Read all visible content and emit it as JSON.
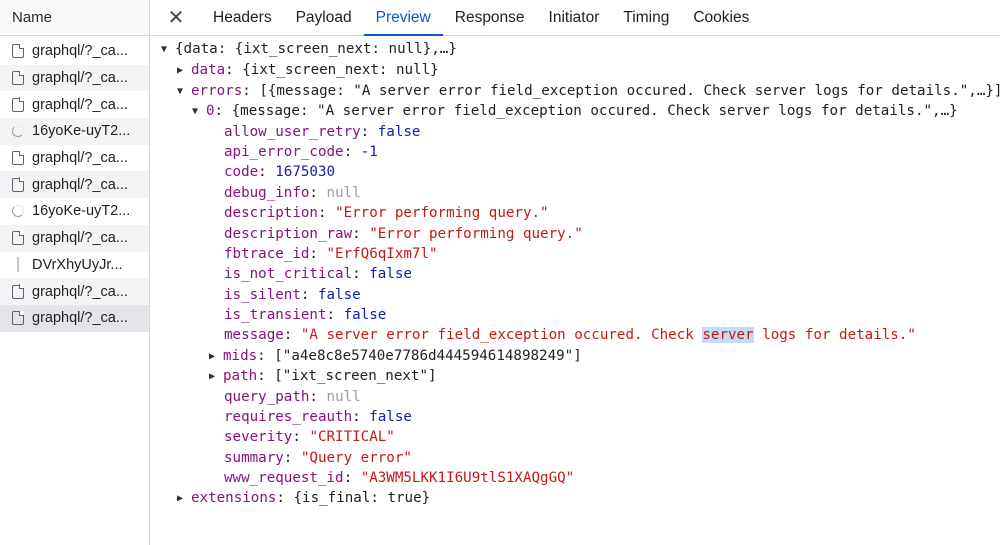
{
  "request_list": {
    "header": "Name",
    "rows": [
      {
        "icon": "document-icon",
        "name": "graphql/?_ca..."
      },
      {
        "icon": "document-icon",
        "name": "graphql/?_ca..."
      },
      {
        "icon": "document-icon",
        "name": "graphql/?_ca..."
      },
      {
        "icon": "loading-spinner-icon",
        "name": "16yoKe-uyT2..."
      },
      {
        "icon": "document-icon",
        "name": "graphql/?_ca..."
      },
      {
        "icon": "document-icon",
        "name": "graphql/?_ca..."
      },
      {
        "icon": "loading-spinner-icon",
        "name": "16yoKe-uyT2..."
      },
      {
        "icon": "document-icon",
        "name": "graphql/?_ca..."
      },
      {
        "icon": "script-bar-icon",
        "name": "DVrXhyUyJr..."
      },
      {
        "icon": "document-icon",
        "name": "graphql/?_ca..."
      },
      {
        "icon": "document-icon",
        "name": "graphql/?_ca..."
      }
    ],
    "selected_index": 10
  },
  "tabs": {
    "close_glyph": "✕",
    "items": [
      "Headers",
      "Payload",
      "Preview",
      "Response",
      "Initiator",
      "Timing",
      "Cookies"
    ],
    "active": "Preview"
  },
  "preview": {
    "root": {
      "summary": "{data: {ixt_screen_next: null},…}"
    },
    "data": {
      "key": "data",
      "summary": "{ixt_screen_next: null}"
    },
    "errors": {
      "key": "errors",
      "summary": "[{message: \"A server error field_exception occured. Check server logs for details.\",…}]"
    },
    "error0": {
      "key": "0",
      "summary": "{message: \"A server error field_exception occured. Check server logs for details.\",…}"
    },
    "fields": {
      "allow_user_retry": "false",
      "api_error_code": "-1",
      "code": "1675030",
      "debug_info": "null",
      "description": "\"Error performing query.\"",
      "description_raw": "\"Error performing query.\"",
      "fbtrace_id": "\"ErfQ6qIxm7l\"",
      "is_not_critical": "false",
      "is_silent": "false",
      "is_transient": "false",
      "message_before": "\"A server error field_exception occured. Check ",
      "message_highlight": "server",
      "message_after": " logs for details.\"",
      "mids": "[\"a4e8c8e5740e7786d444594614898249\"]",
      "path": "[\"ixt_screen_next\"]",
      "query_path": "null",
      "requires_reauth": "false",
      "severity": "\"CRITICAL\"",
      "summary": "\"Query error\"",
      "www_request_id": "\"A3WM5LKK1I6U9tlS1XAQgGQ\""
    },
    "extensions": {
      "key": "extensions",
      "summary": "{is_final: true}"
    }
  },
  "colors": {
    "accent": "#0b57d0",
    "key": "#881280",
    "string": "#c41a16",
    "number": "#1a1aa6",
    "null": "#9aa0a6",
    "search_highlight": "#c4daf5"
  }
}
